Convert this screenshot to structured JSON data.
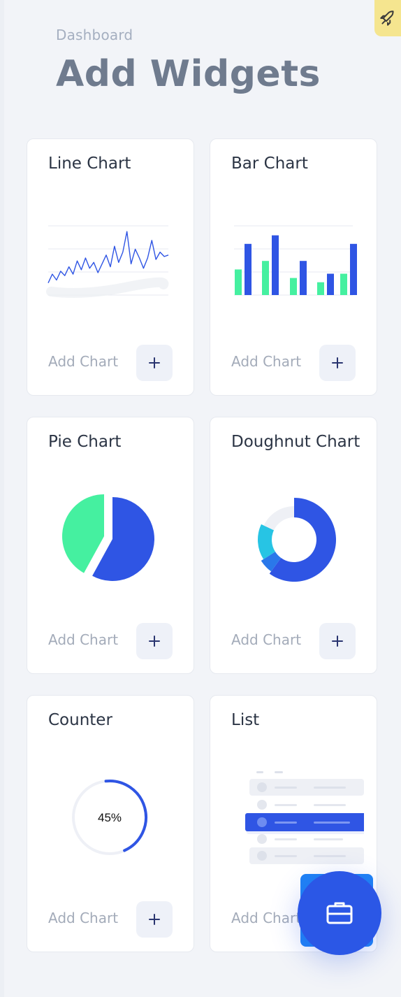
{
  "header": {
    "breadcrumb": "Dashboard",
    "title": "Add Widgets"
  },
  "colors": {
    "page_bg": "#f2f4f8",
    "primary_blue": "#2f55e4",
    "green": "#45f0a0",
    "cyan": "#27c4e4",
    "fab_blue": "#2b57e6",
    "rocket_tab": "#f5e58f"
  },
  "icons": {
    "rocket": "rocket-icon",
    "add": "plus-icon",
    "fab": "briefcase-icon"
  },
  "widgets": [
    {
      "title": "Line Chart",
      "add_label": "Add Chart"
    },
    {
      "title": "Bar Chart",
      "add_label": "Add Chart"
    },
    {
      "title": "Pie Chart",
      "add_label": "Add Chart"
    },
    {
      "title": "Doughnut Chart",
      "add_label": "Add Chart"
    },
    {
      "title": "Counter",
      "add_label": "Add Chart"
    },
    {
      "title": "List",
      "add_label": "Add Chart"
    }
  ],
  "chart_data": [
    {
      "type": "line",
      "values": [
        3,
        9,
        5,
        11,
        8,
        14,
        9,
        18,
        12,
        20,
        13,
        17,
        10,
        16,
        22,
        14,
        28,
        17,
        24,
        38,
        16,
        26,
        20,
        13,
        20,
        32,
        19,
        24,
        21,
        22
      ]
    },
    {
      "type": "bar",
      "series": [
        {
          "values": [
            6,
            8,
            4,
            3,
            5
          ]
        },
        {
          "values": [
            12,
            14,
            8,
            5,
            12
          ]
        }
      ]
    },
    {
      "type": "pie",
      "values": [
        58,
        42
      ]
    },
    {
      "type": "doughnut",
      "values": [
        60,
        6,
        16,
        18
      ]
    },
    {
      "type": "gauge",
      "value_percent": 45,
      "label": "45%"
    }
  ]
}
